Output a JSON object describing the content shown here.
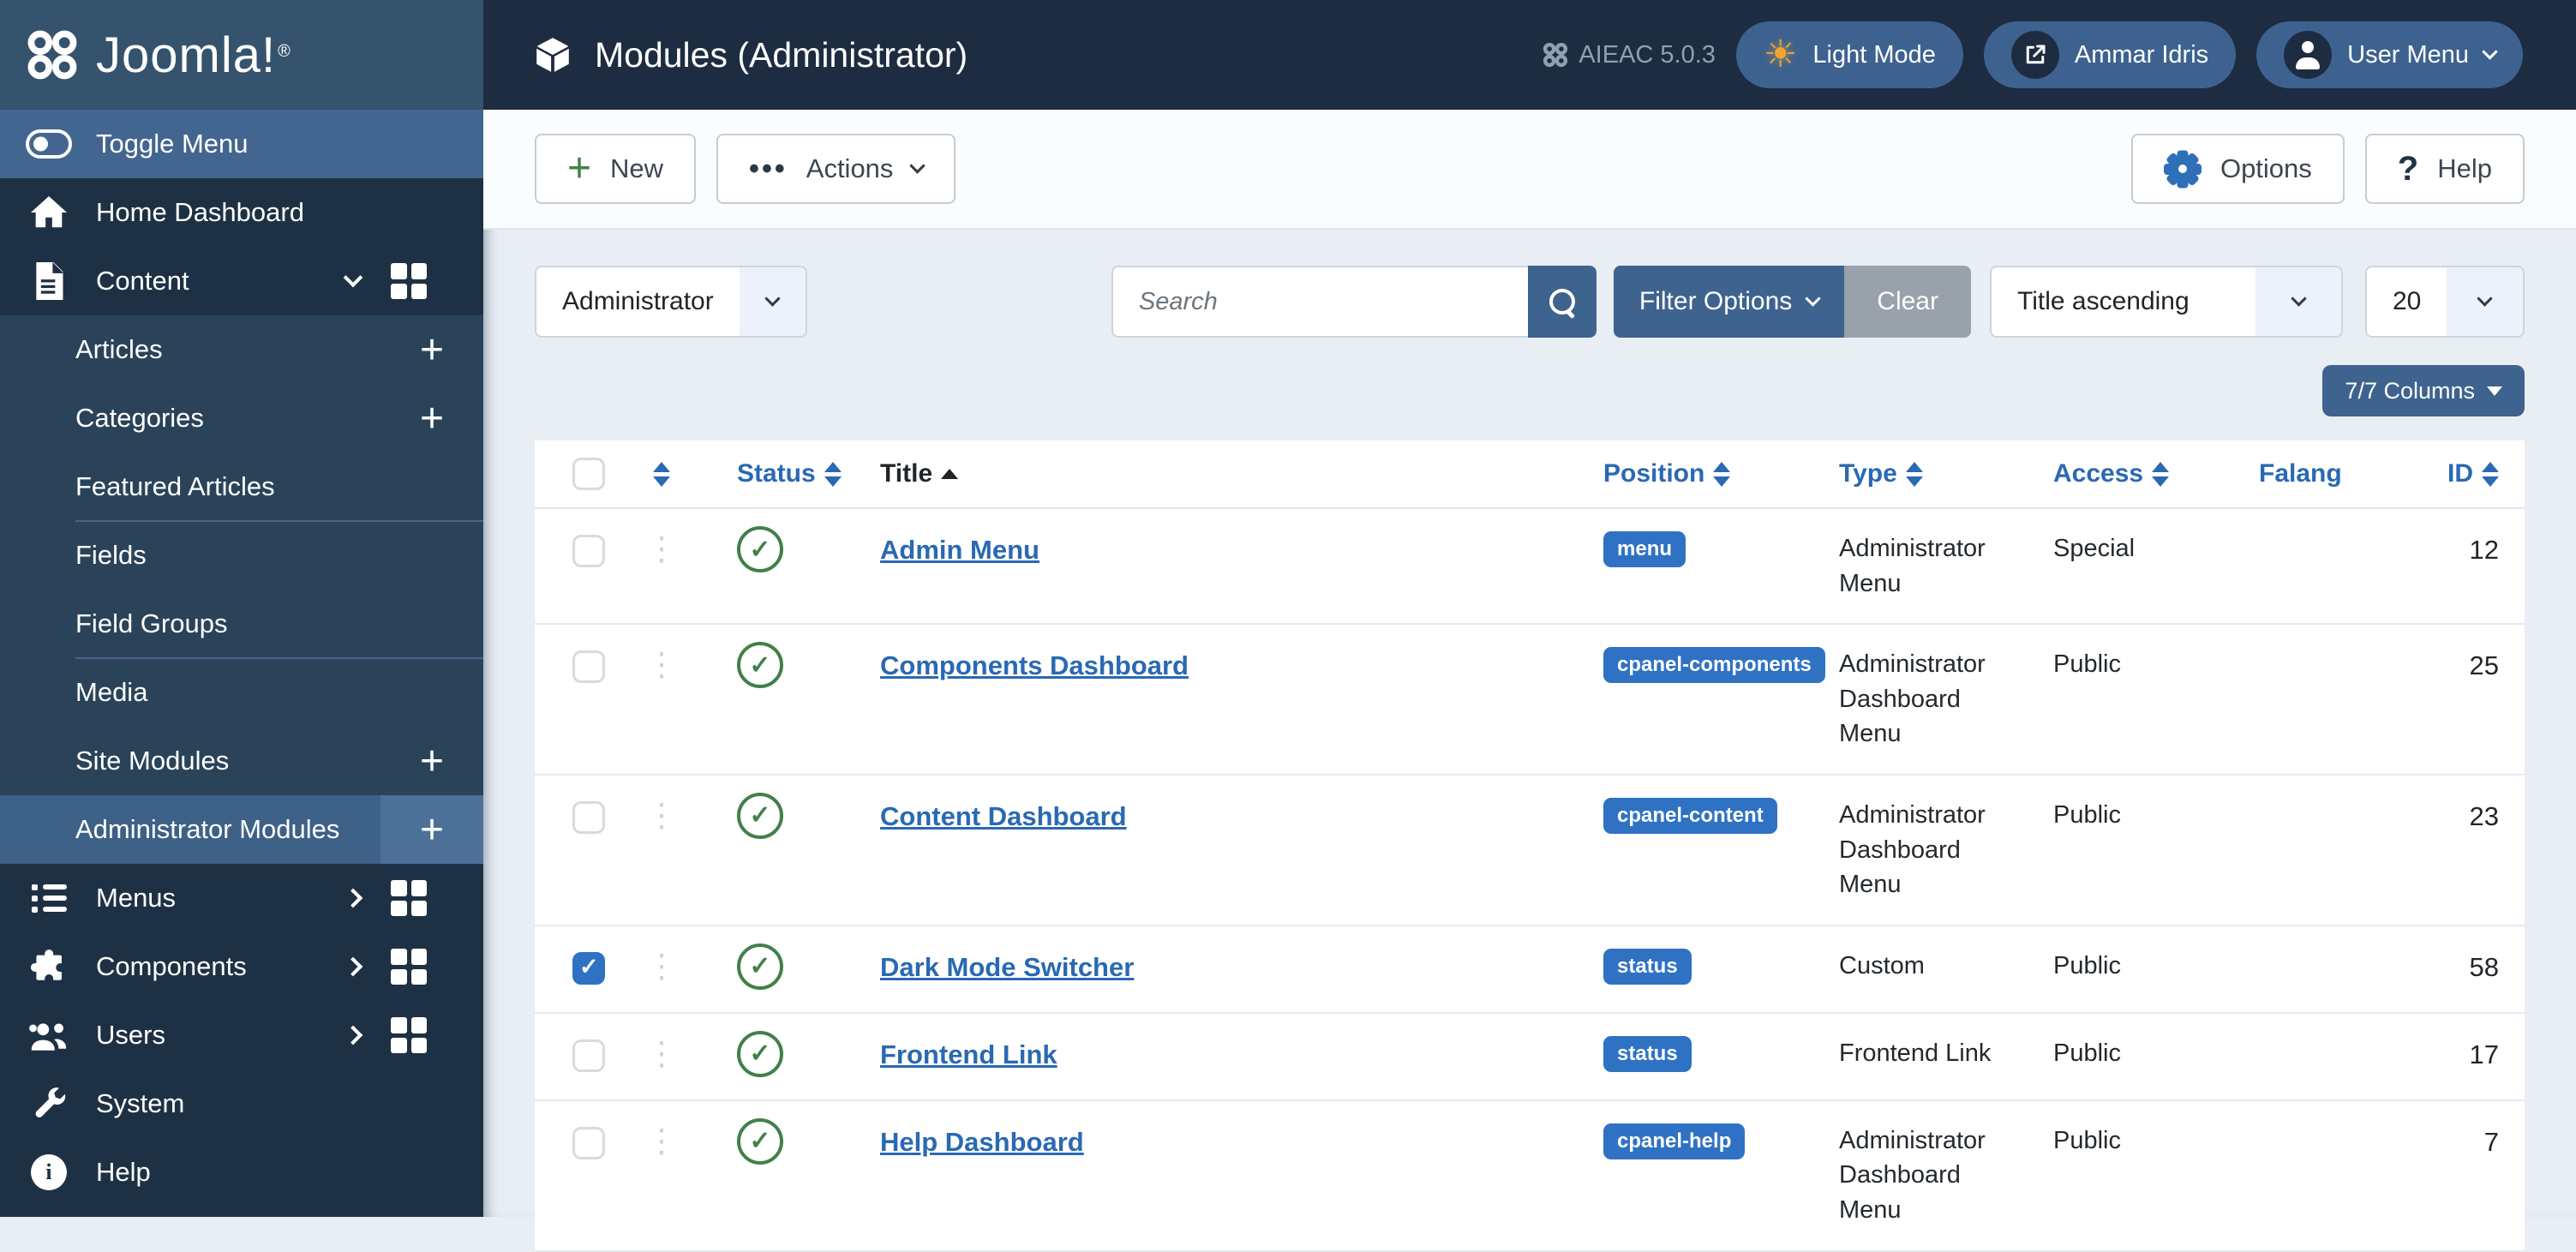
{
  "brand": {
    "name": "Joomla!",
    "reg": "®"
  },
  "topbar": {
    "title": "Modules (Administrator)",
    "version": "AIEAC 5.0.3",
    "light_mode_label": "Light Mode",
    "user_name": "Ammar Idris",
    "user_menu_label": "User Menu"
  },
  "sidebar": {
    "toggle_label": "Toggle Menu",
    "home_label": "Home Dashboard",
    "content_label": "Content",
    "content_children": [
      {
        "label": "Articles",
        "plus": true
      },
      {
        "label": "Categories",
        "plus": true
      },
      {
        "label": "Featured Articles",
        "divider_after": true
      },
      {
        "label": "Fields"
      },
      {
        "label": "Field Groups",
        "divider_after": true
      },
      {
        "label": "Media"
      },
      {
        "label": "Site Modules",
        "plus": true
      },
      {
        "label": "Administrator Modules",
        "plus": true,
        "selected": true
      }
    ],
    "menus_label": "Menus",
    "components_label": "Components",
    "users_label": "Users",
    "system_label": "System",
    "help_label": "Help"
  },
  "toolbar": {
    "new_label": "New",
    "actions_label": "Actions",
    "options_label": "Options",
    "help_label": "Help"
  },
  "filters": {
    "client_value": "Administrator",
    "search_placeholder": "Search",
    "filter_options_label": "Filter Options",
    "clear_label": "Clear",
    "sort_value": "Title ascending",
    "limit_value": "20",
    "columns_label": "7/7 Columns"
  },
  "table": {
    "headers": {
      "status": "Status",
      "title": "Title",
      "position": "Position",
      "type": "Type",
      "access": "Access",
      "falang": "Falang",
      "id": "ID"
    },
    "rows": [
      {
        "title": "Admin Menu",
        "position": "menu",
        "type": "Administrator Menu",
        "access": "Special",
        "id": "12",
        "checked": false
      },
      {
        "title": "Components Dashboard",
        "position": "cpanel-components",
        "type": "Administrator Dashboard Menu",
        "access": "Public",
        "id": "25",
        "checked": false
      },
      {
        "title": "Content Dashboard",
        "position": "cpanel-content",
        "type": "Administrator Dashboard Menu",
        "access": "Public",
        "id": "23",
        "checked": false
      },
      {
        "title": "Dark Mode Switcher",
        "position": "status",
        "type": "Custom",
        "access": "Public",
        "id": "58",
        "checked": true
      },
      {
        "title": "Frontend Link",
        "position": "status",
        "type": "Frontend Link",
        "access": "Public",
        "id": "17",
        "checked": false
      },
      {
        "title": "Help Dashboard",
        "position": "cpanel-help",
        "type": "Administrator Dashboard Menu",
        "access": "Public",
        "id": "7",
        "checked": false
      }
    ]
  },
  "colors": {
    "topbar": "#1d2c40",
    "brand_block": "#36536e",
    "sidebar": "#1e3144",
    "submenu": "#2a4359",
    "selected_item": "#3d6187",
    "toggle_row": "#42668f",
    "pill_blue": "#3e6290",
    "button_blue": "#3e638e",
    "link_blue": "#2a69b3",
    "badge_blue": "#2f72c4",
    "publish_green": "#41804a",
    "clear_gray": "#99a1aa",
    "content_bg": "#e9eef4"
  }
}
